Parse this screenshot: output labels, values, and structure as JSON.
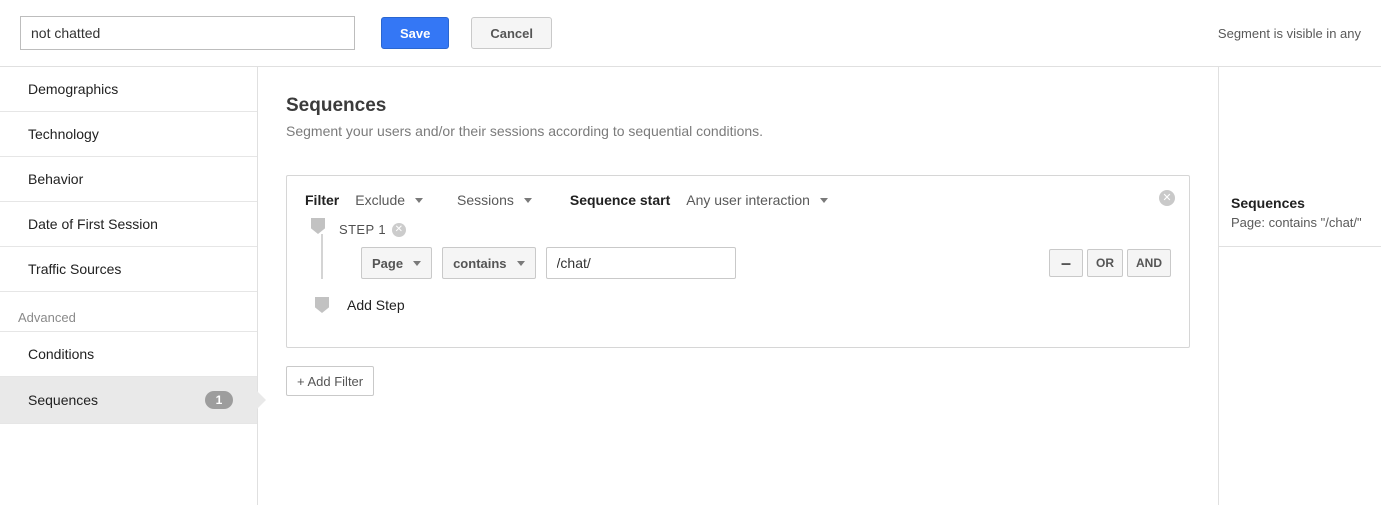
{
  "header": {
    "name_value": "not chatted",
    "save_label": "Save",
    "cancel_label": "Cancel",
    "visibility_text": "Segment is visible in any"
  },
  "sidebar": {
    "items": [
      {
        "label": "Demographics"
      },
      {
        "label": "Technology"
      },
      {
        "label": "Behavior"
      },
      {
        "label": "Date of First Session"
      },
      {
        "label": "Traffic Sources"
      }
    ],
    "advanced_label": "Advanced",
    "advanced_items": [
      {
        "label": "Conditions"
      },
      {
        "label": "Sequences",
        "active": true,
        "badge": "1"
      }
    ]
  },
  "main": {
    "title": "Sequences",
    "subtitle": "Segment your users and/or their sessions according to sequential conditions.",
    "filter": {
      "label": "Filter",
      "include_mode": "Exclude",
      "scope": "Sessions",
      "sequence_start_label": "Sequence start",
      "sequence_start_value": "Any user interaction"
    },
    "step1": {
      "label": "STEP 1",
      "dimension": "Page",
      "match": "contains",
      "value": "/chat/",
      "op_or": "OR",
      "op_and": "AND",
      "op_minus": "–"
    },
    "add_step_label": "Add Step",
    "add_filter_label": "+ Add Filter"
  },
  "summary": {
    "title": "Sequences",
    "line": "Page: contains \"/chat/\""
  }
}
